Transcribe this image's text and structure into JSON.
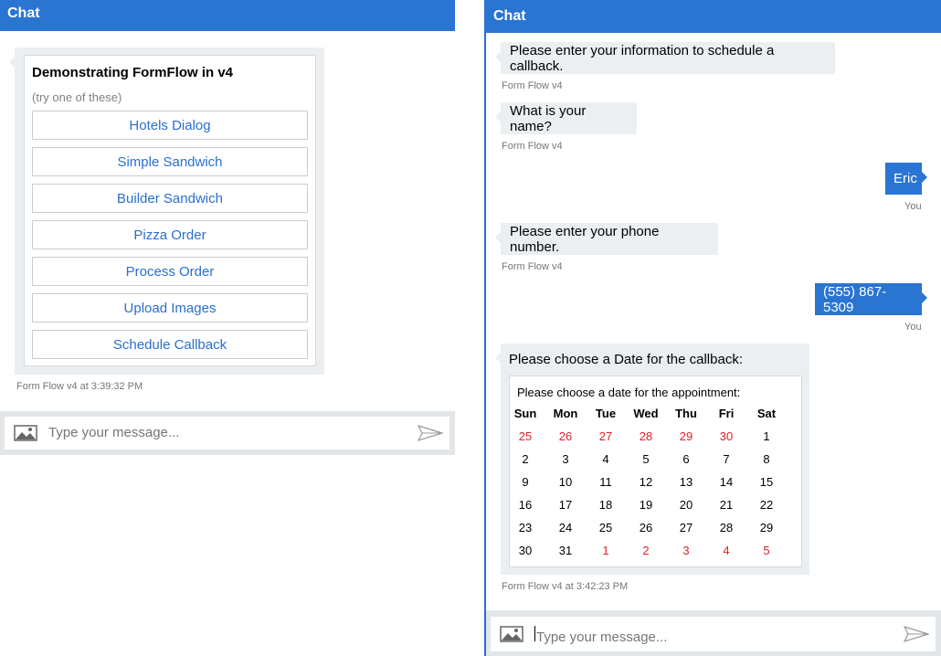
{
  "left": {
    "header_title": "Chat",
    "card": {
      "title": "Demonstrating FormFlow in v4",
      "subtitle": "(try one of these)",
      "buttons": [
        "Hotels Dialog",
        "Simple Sandwich",
        "Builder Sandwich",
        "Pizza Order",
        "Process Order",
        "Upload Images",
        "Schedule Callback"
      ]
    },
    "card_timestamp": "Form Flow v4 at 3:39:32 PM",
    "input_placeholder": "Type your message..."
  },
  "right": {
    "header_title": "Chat",
    "messages": [
      {
        "from": "bot",
        "text": "Please enter your information to schedule a callback.",
        "meta": "Form Flow v4"
      },
      {
        "from": "bot",
        "text": "What is your name?",
        "meta": "Form Flow v4"
      },
      {
        "from": "user",
        "text": "Eric",
        "meta": "You"
      },
      {
        "from": "bot",
        "text": "Please enter your phone number.",
        "meta": "Form Flow v4"
      },
      {
        "from": "user",
        "text": "(555) 867-5309",
        "meta": "You"
      },
      {
        "from": "bot",
        "text": "Please choose a Date for the callback:",
        "meta": "Form Flow v4 at 3:42:23 PM"
      }
    ],
    "calendar": {
      "title": "Please choose a date for the appointment:",
      "weekdays": [
        "Sun",
        "Mon",
        "Tue",
        "Wed",
        "Thu",
        "Fri",
        "Sat"
      ],
      "weeks": [
        [
          "25",
          "26",
          "27",
          "28",
          "29",
          "30",
          "1"
        ],
        [
          "2",
          "3",
          "4",
          "5",
          "6",
          "7",
          "8"
        ],
        [
          "9",
          "10",
          "11",
          "12",
          "13",
          "14",
          "15"
        ],
        [
          "16",
          "17",
          "18",
          "19",
          "20",
          "21",
          "22"
        ],
        [
          "23",
          "24",
          "25",
          "26",
          "27",
          "28",
          "29"
        ],
        [
          "30",
          "31",
          "1",
          "2",
          "3",
          "4",
          "5"
        ]
      ],
      "other_month_color": "#e0202a"
    },
    "input_placeholder": "Type your message..."
  },
  "colors": {
    "accent": "#2a74d2",
    "bot_bubble": "#eceff1",
    "link": "#2a6fcf"
  },
  "icons": {
    "attach": "image-icon",
    "send": "send-icon"
  }
}
